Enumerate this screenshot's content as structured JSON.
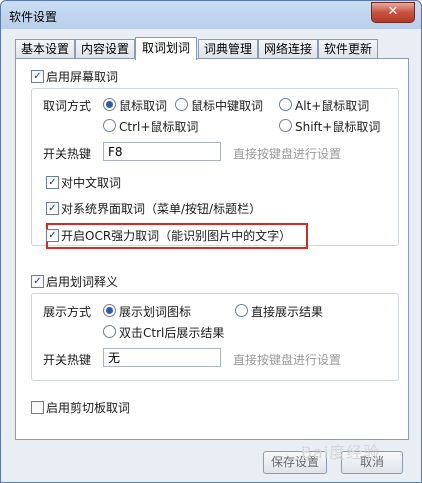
{
  "window": {
    "title": "软件设置",
    "close_glyph": "✕"
  },
  "tabs": [
    {
      "label": "基本设置",
      "active": false
    },
    {
      "label": "内容设置",
      "active": false
    },
    {
      "label": "取词划词",
      "active": true
    },
    {
      "label": "词典管理",
      "active": false
    },
    {
      "label": "网络连接",
      "active": false
    },
    {
      "label": "软件更新",
      "active": false
    }
  ],
  "screen_capture": {
    "enable_label": "启用屏幕取词",
    "enable_checked": true,
    "method_label": "取词方式",
    "methods": [
      {
        "label": "鼠标取词",
        "selected": true
      },
      {
        "label": "鼠标中键取词",
        "selected": false
      },
      {
        "label": "Alt+鼠标取词",
        "selected": false
      },
      {
        "label": "Ctrl+鼠标取词",
        "selected": false
      },
      {
        "label": "Shift+鼠标取词",
        "selected": false
      }
    ],
    "hotkey_label": "开关热键",
    "hotkey_value": "F8",
    "hotkey_hint": "直接按键盘进行设置",
    "chinese_label": "对中文取词",
    "chinese_checked": true,
    "system_ui_label": "对系统界面取词（菜单/按钮/标题栏）",
    "system_ui_checked": true,
    "ocr_label": "开启OCR强力取词（能识别图片中的文字）",
    "ocr_checked": true
  },
  "selection": {
    "enable_label": "启用划词释义",
    "enable_checked": true,
    "display_label": "展示方式",
    "modes": [
      {
        "label": "展示划词图标",
        "selected": true
      },
      {
        "label": "直接展示结果",
        "selected": false
      },
      {
        "label": "双击Ctrl后展示结果",
        "selected": false
      }
    ],
    "hotkey_label": "开关热键",
    "hotkey_value": "无",
    "hotkey_hint": "直接按键盘进行设置"
  },
  "clipboard": {
    "enable_label": "启用剪切板取词",
    "enable_checked": false
  },
  "footer": {
    "save_label": "保存设置",
    "cancel_label": "取消"
  },
  "watermark": "Bai度经验",
  "colors": {
    "highlight_border": "#d22b2b",
    "accent": "#2b5ea8"
  }
}
